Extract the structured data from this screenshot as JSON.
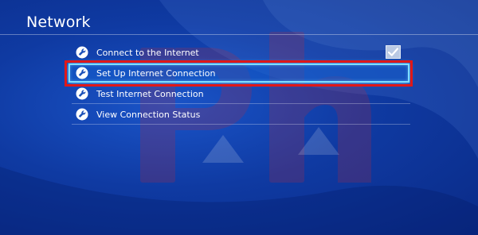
{
  "header": {
    "title": "Network"
  },
  "menu": {
    "items": [
      {
        "label": "Connect to the Internet",
        "icon": "wrench-icon",
        "checked": true
      },
      {
        "label": "Set Up Internet Connection",
        "icon": "wrench-icon",
        "selected": true
      },
      {
        "label": "Test Internet Connection",
        "icon": "wrench-icon"
      },
      {
        "label": "View Connection Status",
        "icon": "wrench-icon"
      }
    ]
  },
  "colors": {
    "background": "#0f3aa2",
    "selection_glow": "#7fdcff",
    "highlight_box": "#e01818",
    "watermark": "#c0283a"
  }
}
